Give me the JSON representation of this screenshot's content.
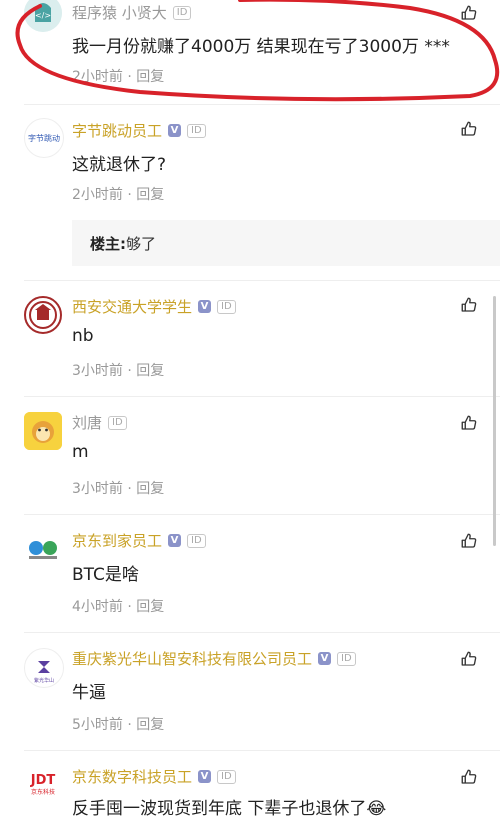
{
  "colors": {
    "vip_name": "#c9a227",
    "plain_name": "#999999",
    "meta": "#999999",
    "annotation": "#d8222a"
  },
  "comments": [
    {
      "name": "程序猿 小贤大",
      "verified": false,
      "id_badge": "ID",
      "text": "我一月份就赚了4000万 结果现在亏了3000万 ***",
      "meta": "2小时前 · 回复"
    },
    {
      "name": "字节跳动员工",
      "verified": true,
      "id_badge": "ID",
      "text": "这就退休了?",
      "meta": "2小时前 · 回复",
      "reply": {
        "owner": "楼主:",
        "text": " 够了"
      }
    },
    {
      "name": "西安交通大学学生",
      "verified": true,
      "id_badge": "ID",
      "text": "nb",
      "meta": "3小时前 · 回复"
    },
    {
      "name": "刘唐",
      "verified": false,
      "id_badge": "ID",
      "text": "m",
      "meta": "3小时前 · 回复"
    },
    {
      "name": "京东到家员工",
      "verified": true,
      "id_badge": "ID",
      "text": "BTC是啥",
      "meta": "4小时前 · 回复"
    },
    {
      "name": "重庆紫光华山智安科技有限公司员工",
      "verified": true,
      "id_badge": "ID",
      "text": "牛逼",
      "meta": "5小时前 · 回复"
    },
    {
      "name": "京东数字科技员工",
      "verified": true,
      "id_badge": "ID",
      "text": "反手囤一波现货到年底 下辈子也退休了😂",
      "meta": ""
    }
  ],
  "logos": {
    "bytedance": "字节跳动",
    "jdt": "JDT",
    "jdt_sub": "京东科技",
    "unis": "紫光华山"
  },
  "badge_v": "V"
}
